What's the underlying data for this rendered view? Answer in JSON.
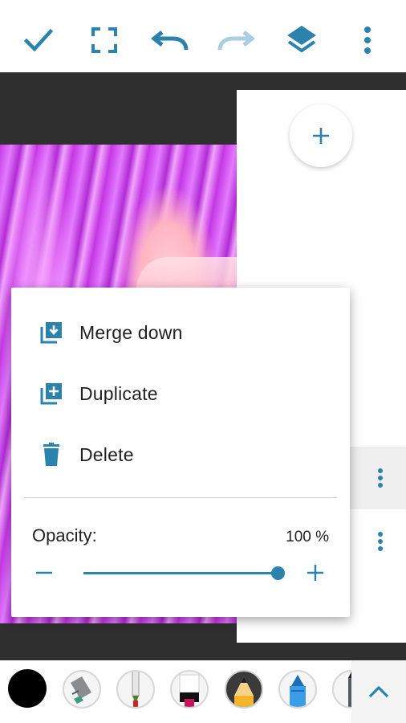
{
  "toolbar": {
    "icons": [
      "check-icon",
      "fullscreen-icon",
      "undo-icon",
      "redo-icon",
      "layers-icon",
      "more-vertical-icon"
    ],
    "accent_color": "#2a82ad",
    "disabled_color": "#a9cfe0"
  },
  "layers_panel": {
    "add_icon": "plus-icon",
    "rows": [
      {
        "selected": true,
        "more_icon": "more-vertical-icon"
      },
      {
        "selected": false,
        "more_icon": "more-vertical-icon"
      }
    ]
  },
  "layer_menu": {
    "items": [
      {
        "label": "Merge down",
        "icon": "merge-down-icon"
      },
      {
        "label": "Duplicate",
        "icon": "duplicate-icon"
      },
      {
        "label": "Delete",
        "icon": "trash-icon"
      }
    ],
    "opacity": {
      "label": "Opacity:",
      "value_text": "100 %",
      "value": 100,
      "min": 0,
      "max": 100
    }
  },
  "brush_bar": {
    "current_color": "#000000",
    "tools": [
      "color-swatch",
      "eraser-tool",
      "pen-tool",
      "marker-tool",
      "pencil-tool",
      "crayon-tool",
      "brush-tool"
    ],
    "expand_icon": "chevron-up-icon"
  }
}
